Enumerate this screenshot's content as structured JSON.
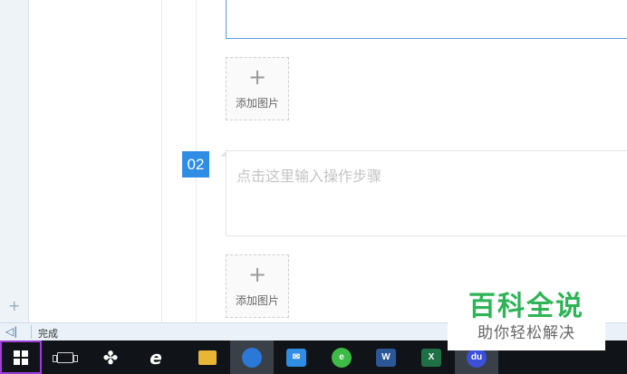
{
  "editor": {
    "add_image_label": "添加图片",
    "step2_number": "02",
    "step2_placeholder": "点击这里输入操作步骤"
  },
  "statusbar": {
    "text": "完成"
  },
  "watermark": {
    "title": "百科全说",
    "subtitle": "助你轻松解决"
  },
  "taskbar": {
    "items": [
      "start-icon",
      "task-view-icon",
      "fan-app-icon",
      "ie-icon",
      "file-explorer-icon",
      "sogou-browser-icon",
      "kingsoft-mail-icon",
      "360-browser-icon",
      "word-icon",
      "excel-icon",
      "baidu-icon"
    ]
  },
  "colors": {
    "accent": "#2f8de4",
    "watermark_green": "#2eb457",
    "taskbar": "#101318",
    "start_highlight": "#9b3fd6"
  }
}
